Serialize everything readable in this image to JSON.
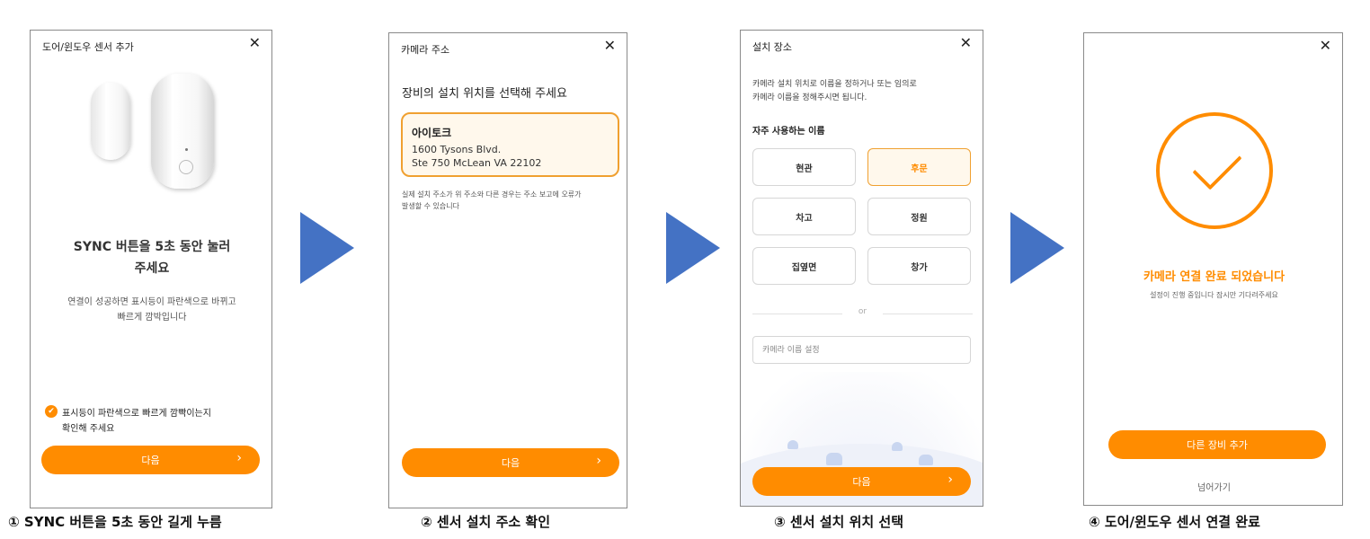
{
  "colors": {
    "accent": "#ff8c00",
    "arrow": "#4472c4",
    "border": "#8a8a8a"
  },
  "icons": {
    "close": "close-icon",
    "check": "check-circle-icon",
    "chevron": "chevron-right-icon",
    "success": "checkmark-circle-icon",
    "step_arrow": "play-arrow-icon"
  },
  "panel1": {
    "title": "도어/윈도우 센서 추가",
    "heading_line1": "SYNC 버튼을 5초 동안 눌러",
    "heading_line2": "주세요",
    "desc_line1": "연결이 성공하면 표시등이 파란색으로 바뀌고",
    "desc_line2": "빠르게 깜박입니다",
    "checkbox_line1": "표시등이 파란색으로 빠르게 깜빡이는지",
    "checkbox_line2": "확인해 주세요",
    "next_label": "다음"
  },
  "panel2": {
    "title": "카메라 주소",
    "heading": "장비의 설치 위치를 선택해 주세요",
    "address": {
      "name": "아이토크",
      "line1": "1600 Tysons Blvd.",
      "line2": "Ste 750 McLean VA 22102"
    },
    "note_line1": "실제 설치 주소가 위 주소와 다른 경우는 주소 보고에 오류가",
    "note_line2": "발생할 수 있습니다",
    "next_label": "다음"
  },
  "panel3": {
    "title": "설치 장소",
    "desc_line1": "카메라 설치 위치로 이름을 정하거나 또는 임의로",
    "desc_line2": "카메라 이름을 정해주시면 됩니다.",
    "section": "자주 사용하는 이름",
    "names": [
      "현관",
      "후문",
      "차고",
      "정원",
      "집옆면",
      "창가"
    ],
    "selected_name": "후문",
    "or_label": "or",
    "input_placeholder": "카메라 이름 설정",
    "next_label": "다음"
  },
  "panel4": {
    "heading": "카메라 연결 완료 되었습니다",
    "sub": "설정이 진행 중입니다 잠시만 기다려주세요",
    "add_label": "다른 장비 추가",
    "skip_label": "넘어가기"
  },
  "captions": [
    "① SYNC 버튼을 5초 동안 길게 누름",
    "② 센서 설치 주소 확인",
    "③ 센서 설치 위치 선택",
    "④ 도어/윈도우 센서 연결 완료"
  ]
}
